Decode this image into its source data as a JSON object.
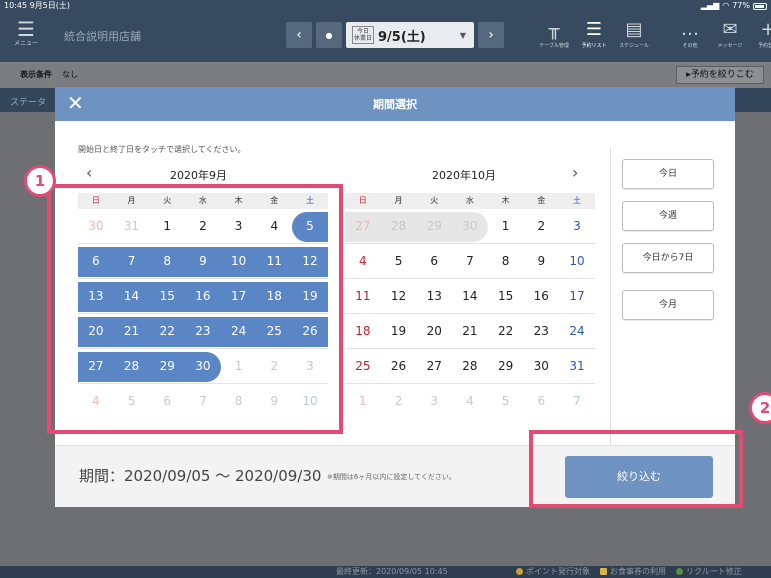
{
  "status": {
    "time": "10:45  9月5日(土)",
    "right": "77%"
  },
  "nav": {
    "menu_label": "メニュー",
    "store_name": "統合説明用店舗",
    "today_tag_line1": "今日",
    "today_tag_line2": "休業日",
    "date": "9/5(土)",
    "icons": [
      {
        "label": "テーブル管理",
        "icon": "table-icon",
        "glyph": "╥"
      },
      {
        "label": "予約リスト",
        "icon": "list-icon",
        "glyph": "☰"
      },
      {
        "label": "スケジュール",
        "icon": "schedule-icon",
        "glyph": "▤"
      },
      {
        "label": "その他",
        "icon": "more-icon",
        "glyph": "…"
      },
      {
        "label": "メッセージ",
        "icon": "mail-icon",
        "glyph": "✉"
      },
      {
        "label": "予約登録",
        "icon": "plus-icon",
        "glyph": "+"
      }
    ]
  },
  "filter": {
    "label": "表示条件",
    "value": "なし",
    "button": "▸予約を絞りこむ"
  },
  "status_band": "ステータ",
  "modal": {
    "title": "期間選択",
    "instruction": "開始日と終了日をタッチで選択してください。",
    "weekdays": [
      "日",
      "月",
      "火",
      "水",
      "木",
      "金",
      "土"
    ],
    "month1": {
      "title": "2020年9月",
      "weeks": [
        [
          "30",
          "31",
          "1",
          "2",
          "3",
          "4",
          "5"
        ],
        [
          "6",
          "7",
          "8",
          "9",
          "10",
          "11",
          "12"
        ],
        [
          "13",
          "14",
          "15",
          "16",
          "17",
          "18",
          "19"
        ],
        [
          "20",
          "21",
          "22",
          "23",
          "24",
          "25",
          "26"
        ],
        [
          "27",
          "28",
          "29",
          "30",
          "1",
          "2",
          "3"
        ],
        [
          "4",
          "5",
          "6",
          "7",
          "8",
          "9",
          "10"
        ]
      ]
    },
    "month2": {
      "title": "2020年10月",
      "weeks": [
        [
          "27",
          "28",
          "29",
          "30",
          "1",
          "2",
          "3"
        ],
        [
          "4",
          "5",
          "6",
          "7",
          "8",
          "9",
          "10"
        ],
        [
          "11",
          "12",
          "13",
          "14",
          "15",
          "16",
          "17"
        ],
        [
          "18",
          "19",
          "20",
          "21",
          "22",
          "23",
          "24"
        ],
        [
          "25",
          "26",
          "27",
          "28",
          "29",
          "30",
          "31"
        ],
        [
          "1",
          "2",
          "3",
          "4",
          "5",
          "6",
          "7"
        ]
      ]
    },
    "quick_buttons": [
      "今日",
      "今週",
      "今日から7日",
      "今月"
    ],
    "period_text": "期間：2020/09/05 〜 2020/09/30",
    "period_note": "※期間は6ヶ月以内に設定してください。",
    "apply_button": "絞り込む"
  },
  "footer": {
    "updated": "最終更新：2020/09/05 10:45",
    "legend": [
      "ポイント発行対象",
      "お食事券の利用",
      "リクルート修正"
    ]
  },
  "annotations": {
    "badge1": "1",
    "badge2": "2"
  },
  "colors": {
    "accent": "#6e93c0",
    "selection": "#5b86c5",
    "highlight": "#e34a74",
    "sunday": "#c4222a",
    "saturday": "#2d58b0"
  }
}
